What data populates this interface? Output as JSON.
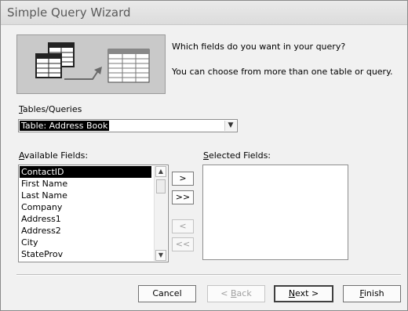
{
  "window": {
    "title": "Simple Query Wizard"
  },
  "prompt": {
    "question": "Which fields do you want in your query?",
    "hint": "You can choose from more than one table or query."
  },
  "tables": {
    "label_accel": "T",
    "label_rest": "ables/Queries",
    "selected": "Table: Address Book"
  },
  "available": {
    "label_accel": "A",
    "label_rest": "vailable Fields:",
    "items": [
      "ContactID",
      "First Name",
      "Last Name",
      "Company",
      "Address1",
      "Address2",
      "City",
      "StateProv"
    ],
    "selected_index": 0
  },
  "selected_fields": {
    "label_accel": "S",
    "label_rest": "elected Fields:",
    "items": []
  },
  "move_buttons": {
    "add_one": ">",
    "add_all": ">>",
    "remove_one": "<",
    "remove_all": "<<"
  },
  "footer": {
    "cancel": "Cancel",
    "back_prefix": "< ",
    "back_accel": "B",
    "back_rest": "ack",
    "next_accel": "N",
    "next_rest": "ext >",
    "finish_accel": "F",
    "finish_rest": "inish"
  },
  "icons": {
    "wizard_illustration": "tables-to-table-arrow-icon",
    "dropdown": "chevron-down-icon",
    "scroll_up": "scroll-up-icon",
    "scroll_down": "scroll-down-icon"
  },
  "colors": {
    "dialog_bg": "#f1f1f1",
    "selection_bg": "#000000",
    "selection_fg": "#ffffff",
    "disabled_text": "#9d9d9d"
  }
}
